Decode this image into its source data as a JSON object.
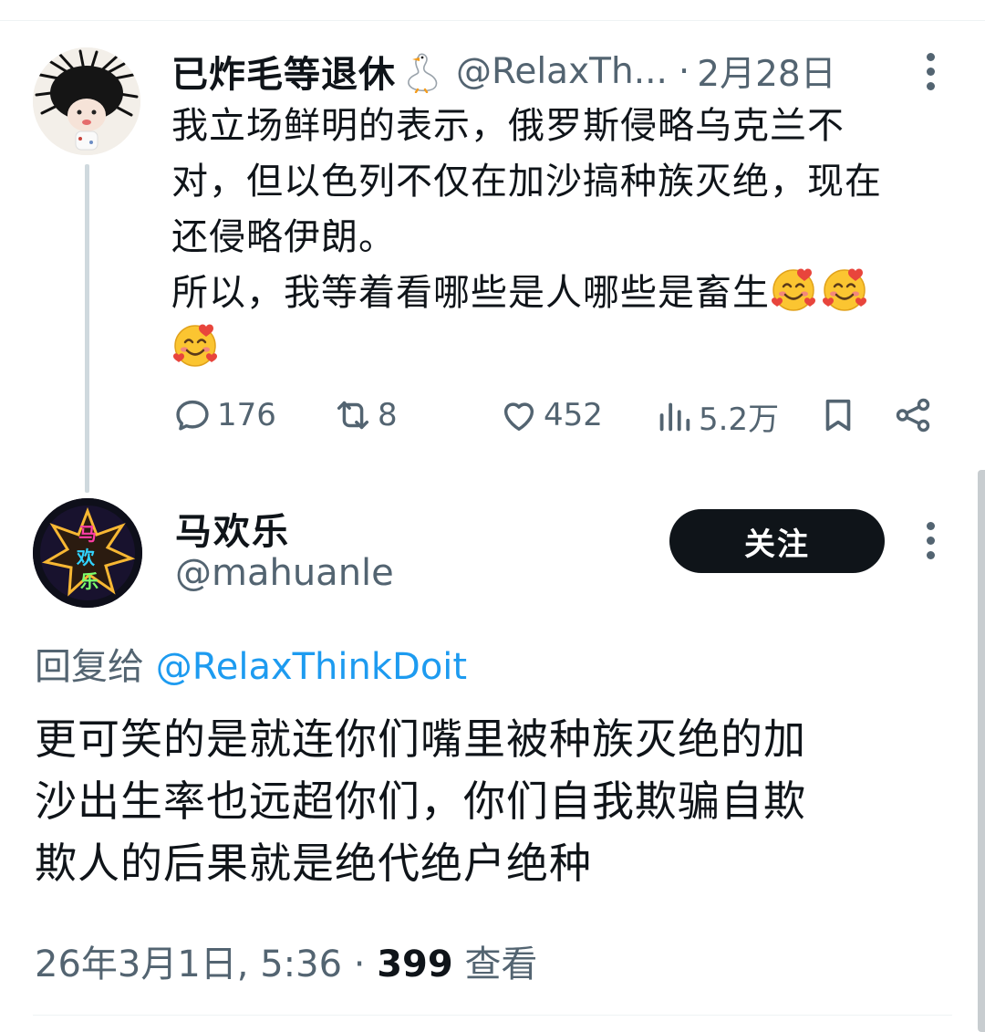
{
  "parent_tweet": {
    "author_name": "已炸毛等退休",
    "author_handle": "@RelaxTh...",
    "separator": "·",
    "date": "2月28日",
    "text_lines": [
      "我立场鲜明的表示，俄罗斯侵略乌克兰不",
      "对，但以色列不仅在加沙搞种族灭绝，现在",
      "还侵略伊朗。",
      "所以，我等着看哪些是人哪些是畜生"
    ],
    "emoji": "smiling-face-with-hearts",
    "emoji_count": 3,
    "stats": {
      "replies": "176",
      "reposts": "8",
      "likes": "452",
      "views": "5.2万"
    }
  },
  "reply_tweet": {
    "author_name": "马欢乐",
    "author_handle": "@mahuanle",
    "follow_label": "关注",
    "reply_prefix": "回复给",
    "reply_mention": "@RelaxThinkDoit",
    "text_lines": [
      "更可笑的是就连你们嘴里被种族灭绝的加",
      "沙出生率也远超你们，你们自我欺骗自欺",
      "欺人的后果就是绝代绝户绝种"
    ],
    "timestamp": "26年3月1日, 5:36",
    "separator": "·",
    "view_count": "399",
    "view_label": "查看"
  },
  "colors": {
    "text": "#0f1419",
    "secondary": "#536471",
    "link": "#1d9bf0",
    "divider": "#eff3f4",
    "button_bg": "#0f1419"
  },
  "icons": [
    "more-icon",
    "reply-icon",
    "repost-icon",
    "like-icon",
    "views-icon",
    "bookmark-icon",
    "share-icon",
    "goose-emoji"
  ]
}
